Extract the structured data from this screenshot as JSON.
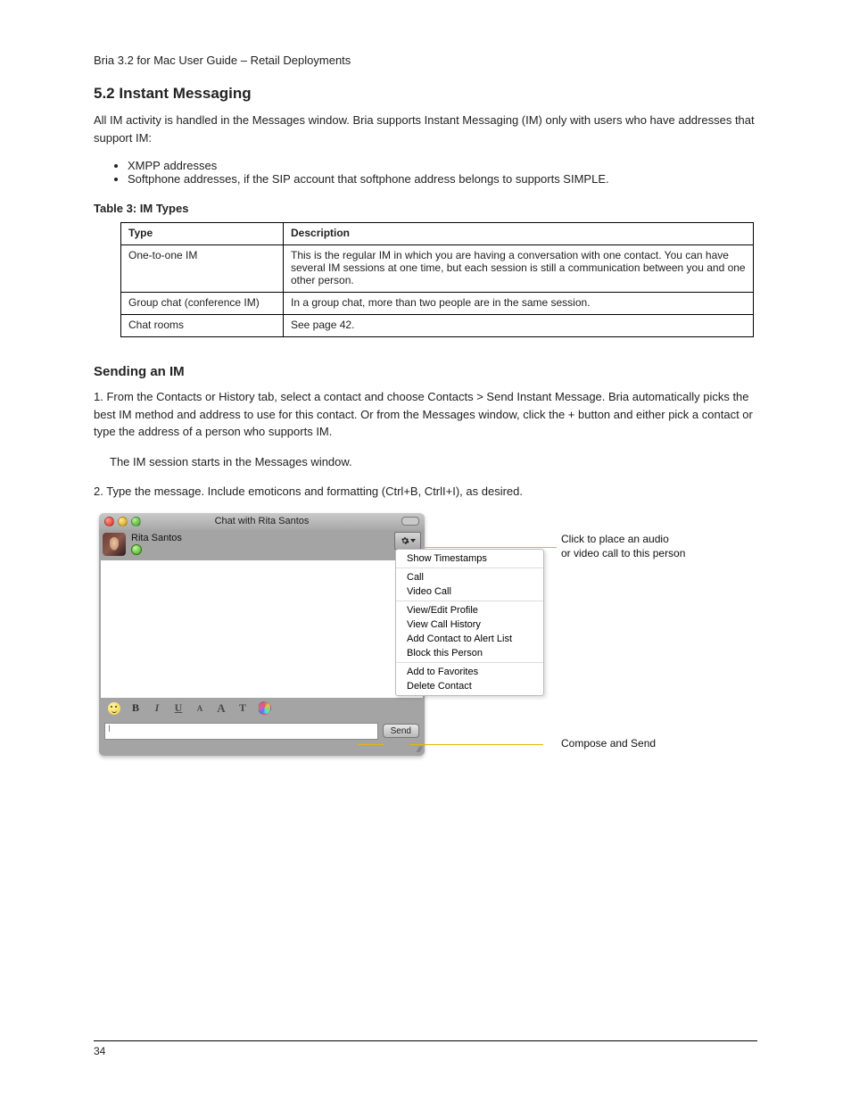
{
  "product_name": "Bria 3.2 for Mac User Guide – Retail Deployments",
  "section": {
    "number_title": "5.2 Instant Messaging",
    "subhead_send": "Sending an IM",
    "lead_para": "All IM activity is handled in the Messages window. Bria supports Instant Messaging (IM) only with users who have addresses that support IM:",
    "bullet_xmpp": "XMPP addresses",
    "bullet_sip": "Softphone addresses, if the SIP account that softphone address belongs to supports SIMPLE.",
    "bullet_text_after": null
  },
  "steps": {
    "step1_title": "1. From the Contacts or History tab, select a contact ",
    "step1_rest": "and choose Contacts > Send Instant Message. Bria automatically picks the best IM method and address to use for this contact. Or from the Messages window, click the + button and either pick a contact or type the address of a person who supports IM.",
    "step2": "The IM session starts in the Messages window.",
    "step3": "2. Type the message. Include emoticons and formatting (Ctrl+B, CtrlI+I), as desired."
  },
  "table": {
    "header_type": "Type",
    "header_desc": "Description",
    "row1_type": "One-to-one IM",
    "row1_desc": "This is the regular IM in which you are having a conversation with one contact. You can have several IM sessions at one time, but each session is still a communication between you and one other person.",
    "row2_type": "Group chat (conference IM)",
    "row2_desc": "In a group chat, more than two people are in the same session.",
    "row3_type": "Chat rooms",
    "row3_desc": "See page 42."
  },
  "chatwin": {
    "title": "Chat with Rita Santos",
    "contact_name": "Rita Santos",
    "send_button": "Send",
    "input_value": "I"
  },
  "popup": {
    "items_group1": [
      "Show Timestamps"
    ],
    "items_group2": [
      "Call",
      "Video Call"
    ],
    "items_group3": [
      "View/Edit Profile",
      "View Call History",
      "Add Contact to Alert List",
      "Block this Person"
    ],
    "items_group4": [
      "Add to Favorites",
      "Delete Contact"
    ]
  },
  "callouts": {
    "top_line1": "Click to place an audio",
    "top_line2": "or video call to this person",
    "bottom": "Compose and Send"
  },
  "footer": {
    "page": "34"
  }
}
